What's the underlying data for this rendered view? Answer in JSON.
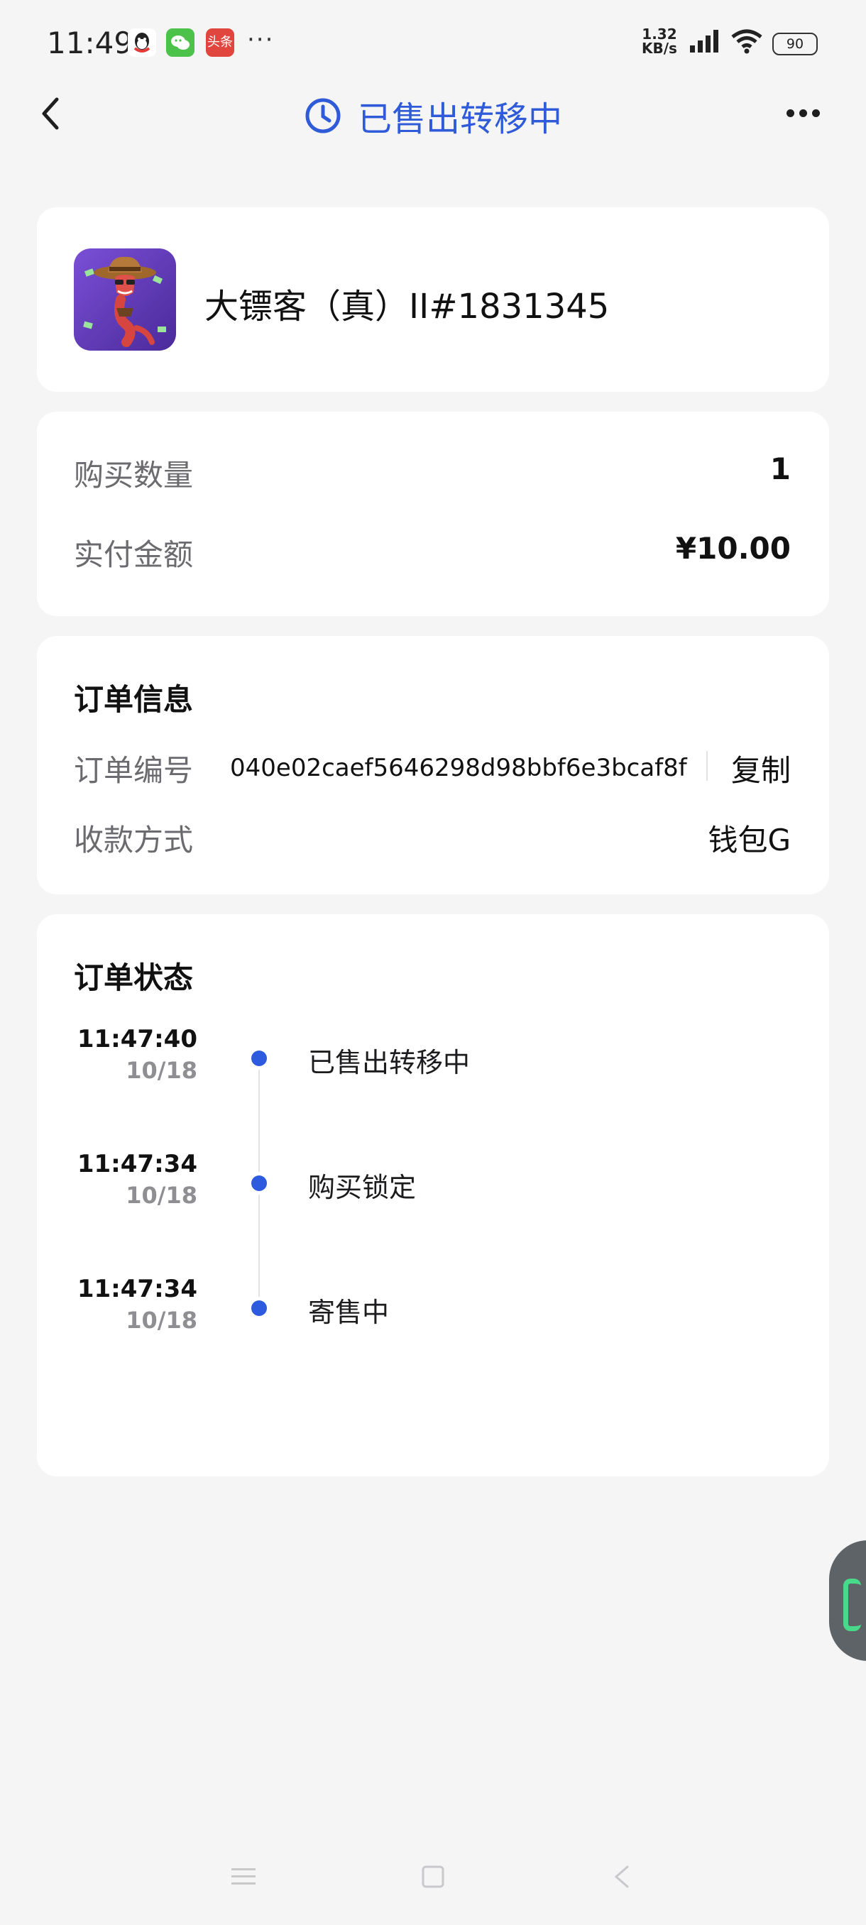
{
  "status_bar": {
    "time": "11:49",
    "app_icons": [
      "qq-icon",
      "wechat-icon",
      "toutiao-icon"
    ],
    "toutiao_label": "头条",
    "more": "···",
    "net_speed_value": "1.32",
    "net_speed_unit": "KB/s",
    "battery": "90"
  },
  "header": {
    "title": "已售出转移中",
    "accent_color": "#2f5bd8"
  },
  "product": {
    "name": "大镖客（真）II#1831345"
  },
  "amount": {
    "quantity_label": "购买数量",
    "quantity_value": "1",
    "paid_label": "实付金额",
    "paid_value": "¥10.00"
  },
  "order_info": {
    "section_title": "订单信息",
    "order_no_label": "订单编号",
    "order_no_value": "040e02caef5646298d98bbf6e3bcaf8f",
    "copy_label": "复制",
    "payment_label": "收款方式",
    "payment_value": "钱包G"
  },
  "order_status": {
    "section_title": "订单状态",
    "events": [
      {
        "time": "11:47:40",
        "date": "10/18",
        "text": "已售出转移中"
      },
      {
        "time": "11:47:34",
        "date": "10/18",
        "text": "购买锁定"
      },
      {
        "time": "11:47:34",
        "date": "10/18",
        "text": "寄售中"
      }
    ],
    "dot_color": "#2e5ae0"
  }
}
